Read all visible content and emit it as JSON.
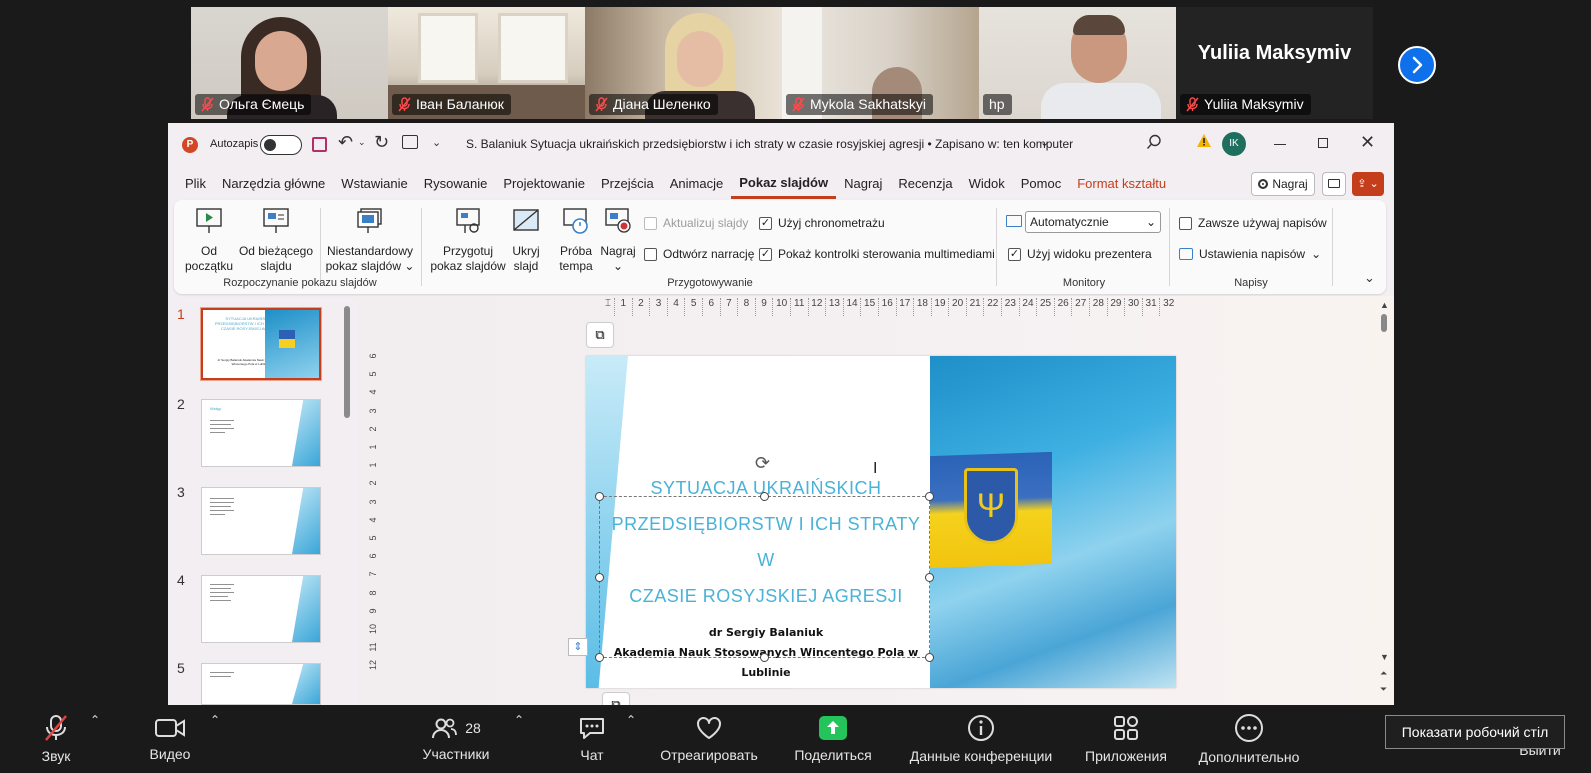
{
  "participants": [
    {
      "name": "Ольга Ємець",
      "muted": true
    },
    {
      "name": "Іван Баланюк",
      "muted": true
    },
    {
      "name": "Діана Шеленко",
      "muted": true
    },
    {
      "name": "Mykola Sakhatskyi",
      "muted": true
    },
    {
      "name": "hp",
      "muted": false,
      "active": true
    },
    {
      "name": "Yuliia Maksymiv",
      "muted": true,
      "display": "Yuliia Maksymiv"
    }
  ],
  "ppt": {
    "autosave_label": "Autozapis",
    "doc_title": "S. Balaniuk Sytuacja ukraińskich przedsiębiorstw i ich straty w czasie rosyjskiej agresji • Zapisano w: ten komputer",
    "user_initials": "IK",
    "tabs": [
      "Plik",
      "Narzędzia główne",
      "Wstawianie",
      "Rysowanie",
      "Projektowanie",
      "Przejścia",
      "Animacje",
      "Pokaz slajdów",
      "Nagraj",
      "Recenzja",
      "Widok",
      "Pomoc",
      "Format kształtu"
    ],
    "record_btn": "Nagraj",
    "ribbon": {
      "from_start": [
        "Od",
        "początku"
      ],
      "from_current": [
        "Od bieżącego",
        "slajdu"
      ],
      "custom": [
        "Niestandardowy",
        "pokaz slajdów"
      ],
      "group1": "Rozpoczynanie pokazu slajdów",
      "setup": [
        "Przygotuj",
        "pokaz slajdów"
      ],
      "hide": [
        "Ukryj",
        "slajd"
      ],
      "rehearse": [
        "Próba",
        "tempa"
      ],
      "record": "Nagraj",
      "update_slides": "Aktualizuj slajdy",
      "play_narration": "Odtwórz narrację",
      "use_timings": "Użyj chronometrażu",
      "show_controls": "Pokaż kontrolki sterowania multimediami",
      "group2": "Przygotowywanie",
      "monitor_value": "Automatycznie",
      "presenter_view": "Użyj widoku prezentera",
      "group3": "Monitory",
      "always_captions": "Zawsze używaj napisów",
      "caption_settings": "Ustawienia napisów",
      "group4": "Napisy"
    },
    "thumbs": [
      {
        "num": "1",
        "title": "SYTUACJA UKRAIŃSKICH PRZEDSIĘBIORSTW I ICH STRATY W CZASIE ROSYJSKIEJ AGRESJI",
        "body": "dr Sergiy Balaniuk Akademia Nauk Stosowanych Wincentego Pola w Lublinie"
      },
      {
        "num": "2",
        "title": "Wstęp",
        "body": ""
      },
      {
        "num": "3",
        "title": "",
        "body": ""
      },
      {
        "num": "4",
        "title": "",
        "body": ""
      },
      {
        "num": "5",
        "title": "",
        "body": ""
      }
    ],
    "ruler_h": [
      "1",
      "2",
      "3",
      "4",
      "5",
      "6",
      "7",
      "8",
      "9",
      "10",
      "11",
      "12",
      "13",
      "14",
      "15",
      "16",
      "17",
      "18",
      "19",
      "20",
      "21",
      "22",
      "23",
      "24",
      "25",
      "26",
      "27",
      "28",
      "29",
      "30",
      "31",
      "32"
    ],
    "ruler_v": [
      "6",
      "5",
      "4",
      "3",
      "2",
      "1",
      "1",
      "2",
      "3",
      "4",
      "5",
      "6",
      "7",
      "8",
      "9",
      "10",
      "11",
      "12"
    ],
    "slide": {
      "title_lines": [
        "SYTUACJA UKRAIŃSKICH",
        "PRZEDSIĘBIORSTW I ICH STRATY W",
        "CZASIE ROSYJSKIEJ AGRESJI"
      ],
      "author": "dr Sergiy Balaniuk",
      "institution": "Akademia Nauk Stosowanych Wincentego Pola w Lublinie"
    }
  },
  "toolbar": {
    "audio": "Звук",
    "video": "Видео",
    "participants": "Участники",
    "participants_count": "28",
    "chat": "Чат",
    "react": "Отреагировать",
    "share": "Поделиться",
    "info": "Данные конференции",
    "apps": "Приложения",
    "more": "Дополнительно",
    "leave": "Выйти",
    "tooltip": "Показати робочий стіл"
  },
  "colors": {
    "accent": "#c43e1c",
    "zoom_blue": "#0e71eb",
    "share_green": "#24c45a",
    "slide_title": "#48b2d9"
  }
}
